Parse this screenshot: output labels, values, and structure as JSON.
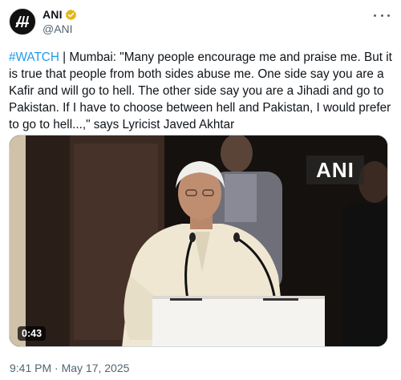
{
  "author": {
    "display_name": "ANI",
    "handle": "@ANI",
    "avatar_text": "ANI"
  },
  "tweet": {
    "hashtag": "#WATCH",
    "body": " | Mumbai: \"Many people encourage me and praise me. But it is true that people from both sides abuse me. One side say you are a Kafir and will go to hell. The other side say you are a Jihadi and go to Pakistan. If I have to choose between hell and Pakistan, I would prefer to go to hell...,\" says Lyricist Javed Akhtar",
    "timestamp": "9:41 PM · May 17, 2025"
  },
  "media": {
    "watermark": "ANI",
    "duration": "0:43"
  },
  "icons": {
    "verified": "verified-badge-icon",
    "more": "more-options-icon"
  },
  "colors": {
    "link": "#1d9bf0",
    "secondary_text": "#536471",
    "verified_badge": "#e2b719"
  }
}
